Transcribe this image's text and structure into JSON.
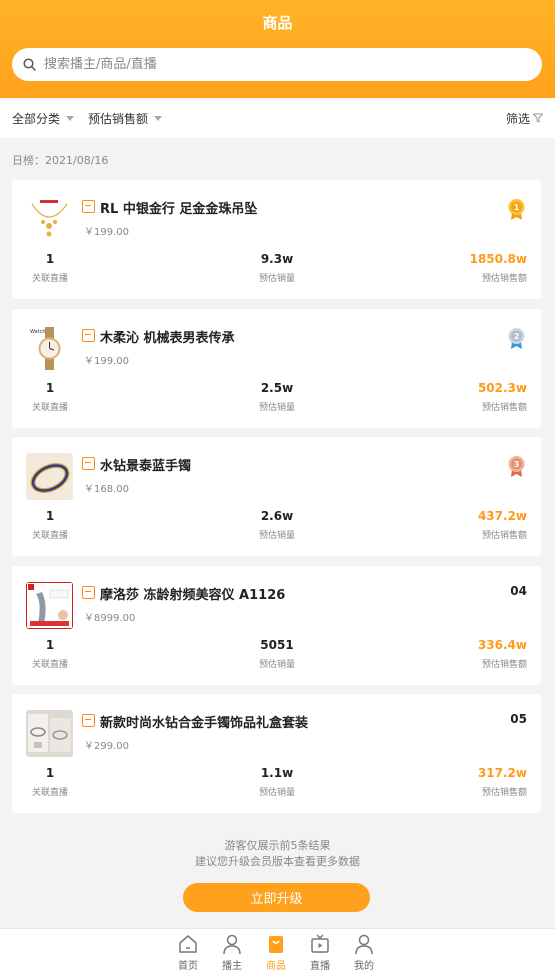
{
  "header": {
    "title": "商品"
  },
  "search": {
    "placeholder": "搜索播主/商品/直播"
  },
  "filters": {
    "category": "全部分类",
    "sort": "预估销售额",
    "screen": "筛选"
  },
  "date_label": "日榜：2021/08/16",
  "stat_labels": {
    "live": "关联直播",
    "sales": "预估销量",
    "revenue": "预估销售额"
  },
  "products": [
    {
      "name": "RL 中银金行 足金金珠吊坠",
      "price": "￥199.00",
      "rank": "",
      "medal": "gold",
      "live": "1",
      "sales": "9.3w",
      "revenue": "1850.8w"
    },
    {
      "name": "木柔沁 机械表男表传承",
      "price": "￥199.00",
      "rank": "",
      "medal": "silver",
      "live": "1",
      "sales": "2.5w",
      "revenue": "502.3w"
    },
    {
      "name": "水钻景泰蓝手镯",
      "price": "￥168.00",
      "rank": "",
      "medal": "bronze",
      "live": "1",
      "sales": "2.6w",
      "revenue": "437.2w"
    },
    {
      "name": "摩洛莎 冻龄射频美容仪  A1126",
      "price": "￥8999.00",
      "rank": "04",
      "medal": "",
      "live": "1",
      "sales": "5051",
      "revenue": "336.4w"
    },
    {
      "name": "新款时尚水钻合金手镯饰品礼盒套装",
      "price": "￥299.00",
      "rank": "05",
      "medal": "",
      "live": "1",
      "sales": "1.1w",
      "revenue": "317.2w"
    }
  ],
  "notice": {
    "line1": "游客仅展示前5条结果",
    "line2": "建议您升级会员版本查看更多数据"
  },
  "upgrade_label": "立即升级",
  "tabs": [
    "首页",
    "播主",
    "商品",
    "直播",
    "我的"
  ],
  "colors": {
    "accent": "#ffa21b",
    "value_orange": "#ff9a1a"
  }
}
